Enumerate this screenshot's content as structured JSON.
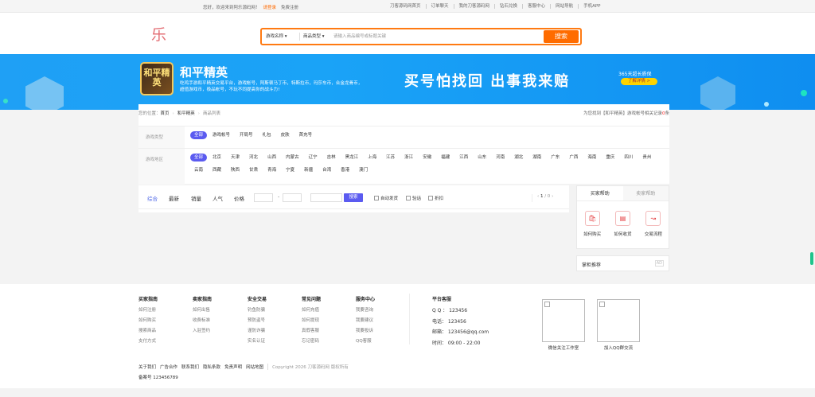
{
  "topbar": {
    "welcome": "您好，欢迎来到阿乐源码网！",
    "login": "请登录",
    "register": "免费注册",
    "links": [
      "刀客源码网首页",
      "订单聊天",
      "我的刀客源码网",
      "钻石兑换",
      "客服中心",
      "网站导航",
      "手机APP"
    ]
  },
  "header": {
    "logo_text": "乐",
    "search": {
      "select1": "游戏名称 ▾",
      "select2": "商品类型 ▾",
      "placeholder": "请输入商品编号或标题关键",
      "button": "搜索"
    }
  },
  "banner": {
    "icon_text": "和平精英",
    "game_name": "和平精英",
    "description": "吃鸡手游和平精英交易平台，游戏帐号，阿斯顿马丁币，特斯拉币，玛莎车币，合金龙骨币，超值游戏币，极品帐号，不玩不同提高你的战斗力!",
    "slogan": "买号怕找回 出事我来赔",
    "guarantee": "365天超长质保",
    "guarantee_btn": "了解详情 >"
  },
  "breadcrumb": {
    "prefix": "您的位置：",
    "home": "首页",
    "game": "和平精英",
    "current": "商品列表"
  },
  "found": {
    "prefix": "为您找到【和平精英】游戏帐号相关记录",
    "count": "0",
    "suffix": "条"
  },
  "filters": {
    "type_label": "游戏类型",
    "types": [
      "全部",
      "游戏帐号",
      "开局号",
      "礼包",
      "皮肤",
      "首充号"
    ],
    "region_label": "游戏地区",
    "regions": [
      "全部",
      "北京",
      "天津",
      "河北",
      "山西",
      "内蒙古",
      "辽宁",
      "吉林",
      "黑龙江",
      "上海",
      "江苏",
      "浙江",
      "安徽",
      "福建",
      "江西",
      "山东",
      "河南",
      "湖北",
      "湖南",
      "广东",
      "广西",
      "海南",
      "重庆",
      "四川",
      "贵州",
      "云南",
      "西藏",
      "陕西",
      "甘肃",
      "青海",
      "宁夏",
      "新疆",
      "台湾",
      "香港",
      "澳门"
    ]
  },
  "sortbar": {
    "tabs": [
      "综合",
      "最新",
      "销量",
      "人气",
      "价格"
    ],
    "dash": "-",
    "search_btn": "搜索",
    "checks": [
      "自动发货",
      "验话",
      "折扣"
    ],
    "pager_prev": "‹",
    "page": "1",
    "total": "/ 0",
    "pager_next": "›"
  },
  "help": {
    "tabs": [
      "买家帮助",
      "卖家帮助"
    ],
    "items": [
      {
        "label": "如何购买",
        "icon": "bag-icon"
      },
      {
        "label": "如何收货",
        "icon": "box-icon"
      },
      {
        "label": "交易流程",
        "icon": "flow-icon"
      }
    ]
  },
  "recommend": {
    "title": "掌柜推荐",
    "ad": "AD"
  },
  "footer": {
    "columns": [
      {
        "title": "买家指南",
        "links": [
          "如何注册",
          "如何购买",
          "搜索商品",
          "支付方式"
        ]
      },
      {
        "title": "卖家指南",
        "links": [
          "如何出售",
          "收费标准",
          "入驻签约"
        ]
      },
      {
        "title": "安全交易",
        "links": [
          "钓鱼防骗",
          "预防盗号",
          "谨防诈骗",
          "实名认证"
        ]
      },
      {
        "title": "常见问题",
        "links": [
          "如何充值",
          "如何提现",
          "真假客服",
          "忘记密码"
        ]
      },
      {
        "title": "服务中心",
        "links": [
          "我要咨询",
          "我要建议",
          "我要投诉",
          "QQ客服"
        ]
      }
    ],
    "service": {
      "title": "平台客服",
      "qq": "Q Q ： 123456",
      "phone": "电话： 123456",
      "email": "邮箱： 123456@qq.com",
      "hours": "时间： 09:00 - 22:00"
    },
    "qr1_label": "微信关注工作室",
    "qr2_label": "加入QQ群交流",
    "links": [
      "关于我们",
      "广告合作",
      "联系我们",
      "隐私条款",
      "免责声明",
      "网站地图"
    ],
    "copyright": "Copyright 2026 刀客源码网 版权所有",
    "icp": "备案号 123456789"
  }
}
